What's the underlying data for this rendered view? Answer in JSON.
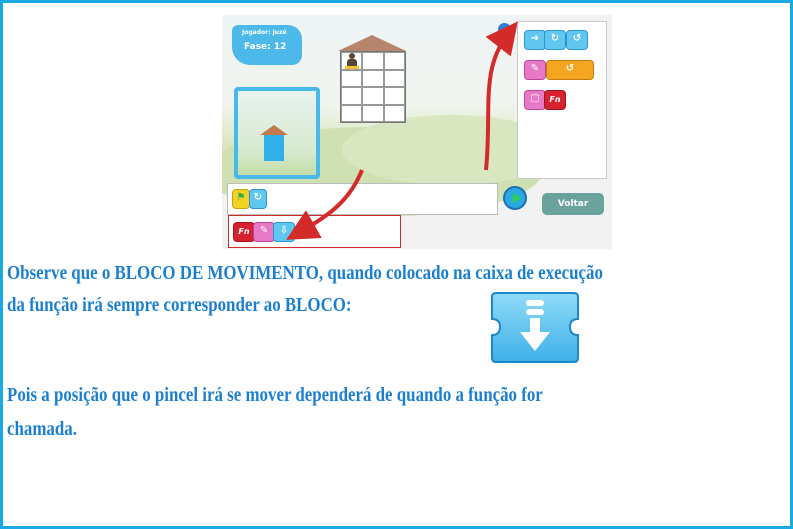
{
  "game": {
    "player_label": "Jogador: Juzé",
    "level_label": "Fase: 12",
    "back_button": "Voltar",
    "function_label": "Fn"
  },
  "text": {
    "line1": "Observe que o BLOCO DE MOVIMENTO, quando colocado na caixa de execução",
    "line2": "da função irá sempre corresponder ao BLOCO:",
    "line3": "Pois a posição que o pincel irá se mover dependerá de quando a função for",
    "line4": "chamada."
  },
  "icons": {
    "move_block": "move-down-block-icon",
    "flag": "green-flag-icon",
    "loop": "loop-icon",
    "paint": "paint-brush-block-icon"
  },
  "colors": {
    "border": "#19a9e4",
    "text": "#1b7fd1",
    "arrow": "#d32a2a",
    "function_block": "#d6222e"
  }
}
